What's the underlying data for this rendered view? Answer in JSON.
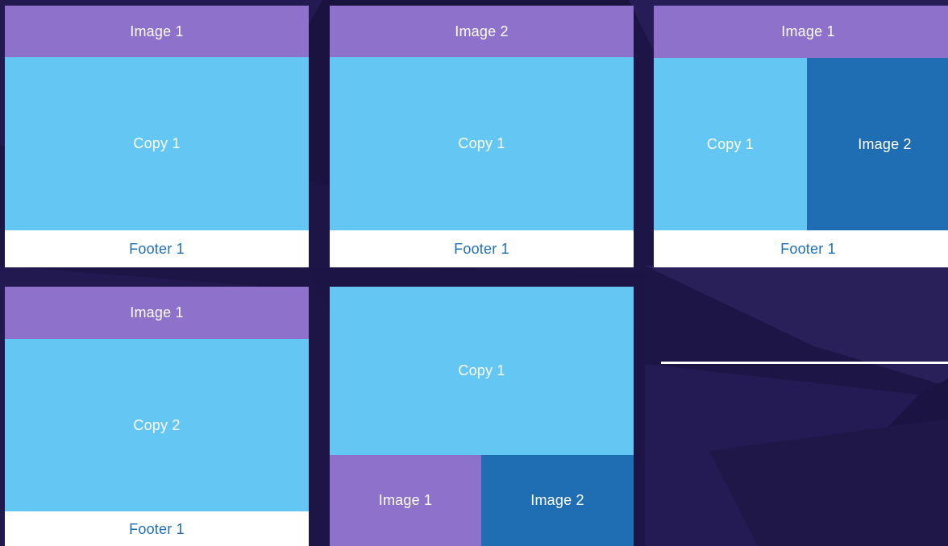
{
  "colors": {
    "background": "#1d1545",
    "image_primary": "#8e71cb",
    "copy": "#64c6f2",
    "image_secondary": "#1f6db3",
    "footer": "#ffffff",
    "footer_text": "#1f6fb2"
  },
  "layouts": [
    {
      "header": "Image 1",
      "body": "Copy 1",
      "footer": "Footer 1"
    },
    {
      "header": "Image 2",
      "body": "Copy 1",
      "footer": "Footer 1"
    },
    {
      "header": "Image 1",
      "body_left": "Copy 1",
      "body_right": "Image 2",
      "footer": "Footer 1"
    },
    {
      "header": "Image 1",
      "body": "Copy 2",
      "footer": "Footer 1"
    },
    {
      "body": "Copy 1",
      "bottom_left": "Image 1",
      "bottom_right": "Image 2"
    }
  ]
}
